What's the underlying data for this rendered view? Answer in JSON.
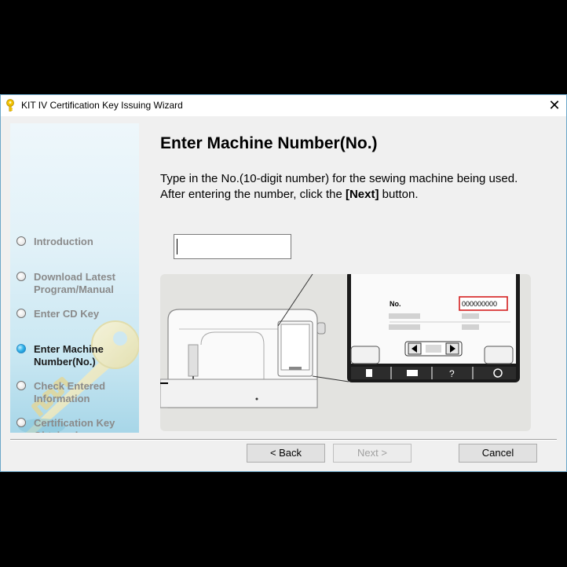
{
  "window": {
    "title": "KIT IV Certification Key Issuing Wizard",
    "close_glyph": "✕"
  },
  "steps": [
    {
      "label": "Introduction",
      "active": false
    },
    {
      "label": "Download Latest\nProgram/Manual",
      "active": false
    },
    {
      "label": "Enter CD Key",
      "active": false
    },
    {
      "label": "Enter Machine\nNumber(No.)",
      "active": true
    },
    {
      "label": "Check Entered\nInformation",
      "active": false
    },
    {
      "label": "Certification Key\nObtained",
      "active": false
    }
  ],
  "main": {
    "title": "Enter Machine Number(No.)",
    "desc_line1": "Type in the No.(10-digit number) for the sewing machine being used.",
    "desc_line2_pre": "After entering the number, click the ",
    "desc_line2_bold": "[Next]",
    "desc_line2_post": " button.",
    "machine_number_value": ""
  },
  "illustration": {
    "no_label": "No.",
    "no_value": "000000000",
    "help_glyph": "?"
  },
  "buttons": {
    "back": "< Back",
    "next": "Next >",
    "cancel": "Cancel"
  },
  "icons": {
    "title_icon": "key-icon",
    "close": "close-icon",
    "step_marker": "radio-icon"
  },
  "colors": {
    "active_step": "#1a1a1a",
    "inactive_step": "#8a8a8a",
    "highlight_box": "#d42020"
  }
}
